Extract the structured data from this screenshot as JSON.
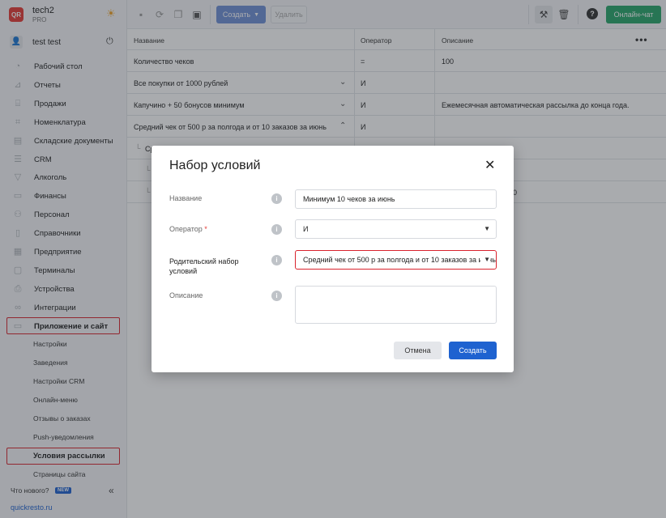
{
  "app": {
    "logo_text": "QR",
    "name": "tech2",
    "plan": "PRO",
    "theme_icon": "sun-icon"
  },
  "user": {
    "name": "test test",
    "logout_icon": "power-icon"
  },
  "sidebar": {
    "items": [
      {
        "label": "Рабочий стол",
        "icon": "dashboard-icon"
      },
      {
        "label": "Отчеты",
        "icon": "chart-icon"
      },
      {
        "label": "Продажи",
        "icon": "cart-icon"
      },
      {
        "label": "Номенклатура",
        "icon": "tag-icon"
      },
      {
        "label": "Складские документы",
        "icon": "document-icon"
      },
      {
        "label": "CRM",
        "icon": "crm-icon"
      },
      {
        "label": "Алкоголь",
        "icon": "glass-icon"
      },
      {
        "label": "Финансы",
        "icon": "finance-icon"
      },
      {
        "label": "Персонал",
        "icon": "people-icon"
      },
      {
        "label": "Справочники",
        "icon": "book-icon"
      },
      {
        "label": "Предприятие",
        "icon": "building-icon"
      },
      {
        "label": "Терминалы",
        "icon": "terminal-icon"
      },
      {
        "label": "Устройства",
        "icon": "printer-icon"
      },
      {
        "label": "Интеграции",
        "icon": "link-icon"
      },
      {
        "label": "Приложение и сайт",
        "icon": "app-icon"
      }
    ],
    "sub_items": [
      {
        "label": "Настройки"
      },
      {
        "label": "Заведения"
      },
      {
        "label": "Настройки CRM"
      },
      {
        "label": "Онлайн-меню"
      },
      {
        "label": "Отзывы о заказах"
      },
      {
        "label": "Push-уведомления"
      },
      {
        "label": "Условия рассылки"
      },
      {
        "label": "Страницы сайта"
      }
    ],
    "whats_new": "Что нового?",
    "new_badge": "NEW",
    "site_link": "quickresto.ru"
  },
  "toolbar": {
    "create_label": "Создать",
    "delete_label": "Удалить",
    "chat_label": "Онлайн-чат"
  },
  "table": {
    "headers": [
      "Название",
      "Оператор",
      "Описание"
    ],
    "rows": [
      {
        "name": "Количество чеков",
        "operator": "=",
        "description": "100",
        "chevron": ""
      },
      {
        "name": "Все покупки от 1000 рублей",
        "operator": "И",
        "description": "",
        "chevron": "⌄"
      },
      {
        "name": "Капучино + 50 бонусов минимум",
        "operator": "И",
        "description": "Ежемесячная автоматическая рассылка до конца года.",
        "chevron": "⌄"
      },
      {
        "name": "Средний чек от 500 р за полгода и от 10 заказов за июнь",
        "operator": "И",
        "description": "",
        "chevron": "⌃"
      },
      {
        "name": "Ср",
        "operator": "",
        "description": "",
        "chevron": ""
      },
      {
        "name": "",
        "operator": "",
        "description": "",
        "chevron": ""
      },
      {
        "name": "",
        "operator": "",
        "description": "0",
        "chevron": ""
      }
    ]
  },
  "modal": {
    "title": "Набор условий",
    "fields": {
      "name_label": "Название",
      "name_value": "Минимум 10 чеков за июнь",
      "operator_label": "Оператор",
      "operator_required": "*",
      "operator_value": "И",
      "parent_label": "Родительский набор условий",
      "parent_value": "Средний чек от 500 р за полгода и от 10 заказов за июнь",
      "description_label": "Описание"
    },
    "cancel_label": "Отмена",
    "submit_label": "Создать"
  },
  "colors": {
    "accent": "#1e62d0",
    "error": "#d9232d",
    "chat": "#27a56a",
    "logo": "#e53935"
  }
}
